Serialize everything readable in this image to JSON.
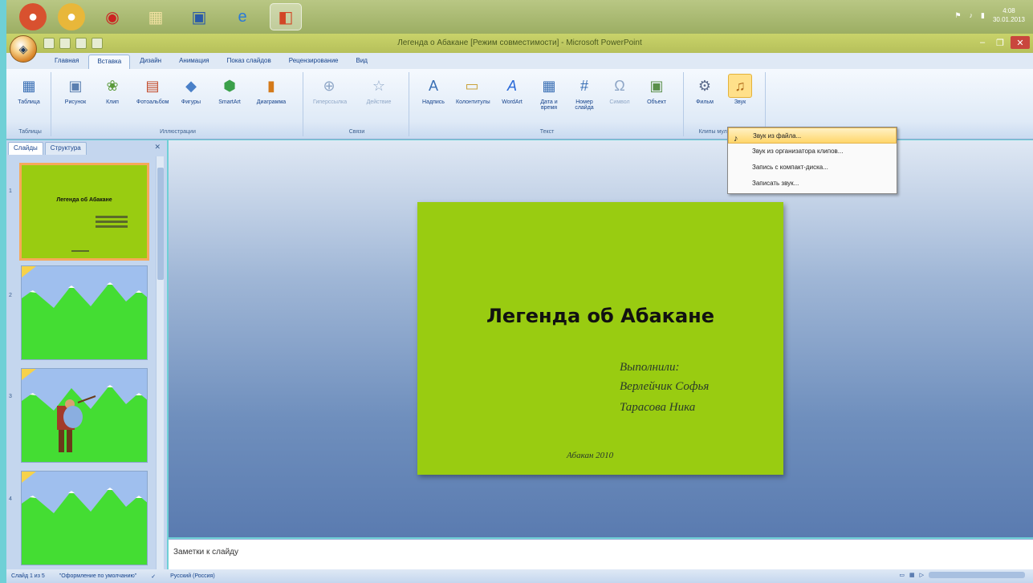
{
  "taskbar": {
    "icons": [
      "chrome-icon",
      "chrome-canary-icon",
      "opera-icon",
      "explorer-icon",
      "word-icon",
      "ie-icon",
      "powerpoint-icon"
    ],
    "clock_time": "4:08",
    "clock_date": "30.01.2013"
  },
  "titlebar": {
    "title": "Легенда о Абакане [Режим совместимости] - Microsoft PowerPoint"
  },
  "ribbon": {
    "tabs": [
      "Главная",
      "Вставка",
      "Дизайн",
      "Анимация",
      "Показ слайдов",
      "Рецензирование",
      "Вид"
    ],
    "active_tab": "Вставка",
    "groups": {
      "tables": {
        "label": "Таблицы",
        "buttons": [
          "Таблица"
        ]
      },
      "illustrations": {
        "label": "Иллюстрации",
        "buttons": [
          "Рисунок",
          "Клип",
          "Фотоальбом",
          "Фигуры",
          "SmartArt",
          "Диаграмма"
        ]
      },
      "links": {
        "label": "Связи",
        "buttons": [
          "Гиперссылка",
          "Действие"
        ]
      },
      "text": {
        "label": "Текст",
        "buttons": [
          "Надпись",
          "Колонтитулы",
          "WordArt",
          "Дата и время",
          "Номер слайда",
          "Символ",
          "Объект"
        ]
      },
      "media": {
        "label": "Клипы мультимедиа",
        "buttons": [
          "Фильм",
          "Звук"
        ]
      }
    }
  },
  "sound_menu": {
    "items": [
      "Звук из файла...",
      "Звук из организатора клипов...",
      "Запись с компакт-диска...",
      "Записать звук..."
    ]
  },
  "left_panel": {
    "tabs": [
      "Слайды",
      "Структура"
    ],
    "slide_numbers": [
      "1",
      "2",
      "3",
      "4"
    ],
    "thumb1_title": "Легенда об Абакане"
  },
  "slide": {
    "title": "Легенда об Абакане",
    "line1": "Выполнили:",
    "line2": "Верлейчик Софья",
    "line3": "Тарасова Ника",
    "footer": "Абакан 2010"
  },
  "notes": {
    "placeholder": "Заметки к слайду"
  },
  "statusbar": {
    "slide_info": "Слайд 1 из 5",
    "theme": "\"Оформление по умолчанию\"",
    "language": "Русский (Россия)"
  },
  "colors": {
    "slide_bg": "#99cc11",
    "hill_green": "#44dd33",
    "sky": "#9fbfee"
  }
}
